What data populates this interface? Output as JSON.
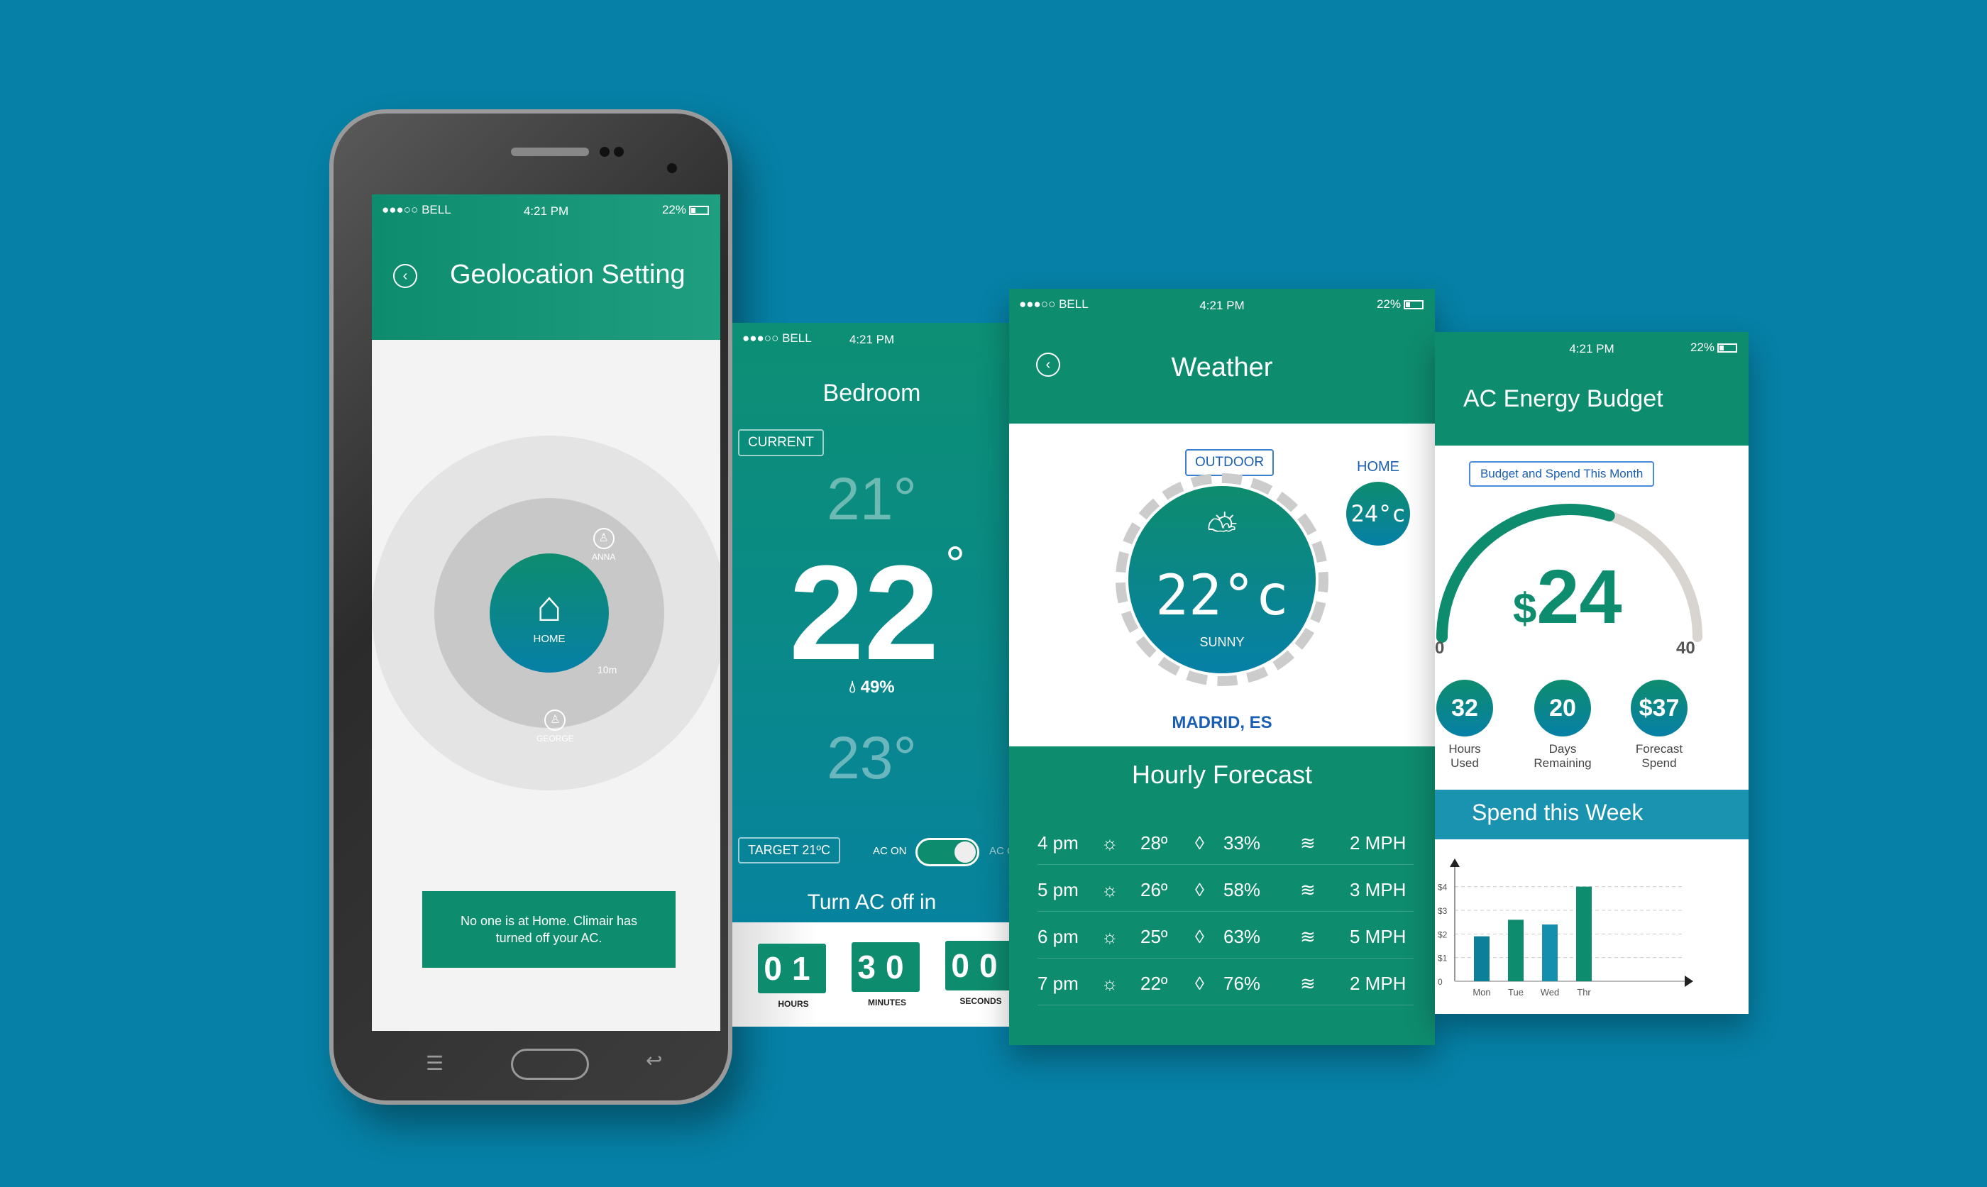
{
  "status_bar": {
    "carrier": "●●●○○ BELL",
    "time": "4:21 PM",
    "battery": "22%"
  },
  "geolocation": {
    "title": "Geolocation Setting",
    "home_label": "HOME",
    "radius_label": "10m",
    "people": [
      {
        "name": "ANNA"
      },
      {
        "name": "GEORGE"
      }
    ],
    "message": "No one is at Home. Climair has turned off your AC."
  },
  "bedroom": {
    "title": "Bedroom",
    "current_label": "CURRENT",
    "temp_above": "21°",
    "temp_current": "22",
    "temp_degree": "°",
    "humidity": "49%",
    "temp_below": "23°",
    "target_label": "TARGET 21ºC",
    "ac_on_label": "AC ON",
    "ac_off_label": "AC OFF",
    "ac_on": true,
    "timer_title": "Turn AC off in",
    "timer": {
      "hours": "01",
      "minutes": "30",
      "seconds": "00"
    },
    "timer_labels": {
      "hours": "HOURS",
      "minutes": "MINUTES",
      "seconds": "SECONDS"
    }
  },
  "weather": {
    "title": "Weather",
    "outdoor_label": "OUTDOOR",
    "home_label": "HOME",
    "home_temp": "24°c",
    "outdoor_temp": "22°c",
    "condition": "SUNNY",
    "location": "MADRID, ES",
    "forecast_title": "Hourly Forecast",
    "forecast": [
      {
        "time": "4 pm",
        "temp": "28º",
        "humidity": "33%",
        "wind": "2 MPH"
      },
      {
        "time": "5 pm",
        "temp": "26º",
        "humidity": "58%",
        "wind": "3 MPH"
      },
      {
        "time": "6 pm",
        "temp": "25º",
        "humidity": "63%",
        "wind": "5 MPH"
      },
      {
        "time": "7 pm",
        "temp": "22º",
        "humidity": "76%",
        "wind": "2 MPH"
      }
    ]
  },
  "energy": {
    "title": "AC Energy Budget",
    "pill": "Budget and Spend This Month",
    "spent_symbol": "$",
    "spent": "24",
    "gauge_min": "0",
    "gauge_max": "40",
    "gauge_fraction": 0.6,
    "stats": [
      {
        "value": "32",
        "label1": "Hours",
        "label2": "Used"
      },
      {
        "value": "20",
        "label1": "Days",
        "label2": "Remaining"
      },
      {
        "value": "$37",
        "label1": "Forecast",
        "label2": "Spend"
      }
    ],
    "week_title": "Spend this Week"
  },
  "chart_data": {
    "type": "bar",
    "title": "Spend this Week",
    "categories": [
      "Mon",
      "Tue",
      "Wed",
      "Thr"
    ],
    "values": [
      1.9,
      2.6,
      2.4,
      4.0
    ],
    "yticks": [
      "0",
      "$1",
      "$2",
      "$3",
      "$4"
    ],
    "ylim": [
      0,
      4.5
    ],
    "colors": [
      "#0c7f9a",
      "#0e8c6e",
      "#1490ae",
      "#0e8c6e"
    ]
  }
}
